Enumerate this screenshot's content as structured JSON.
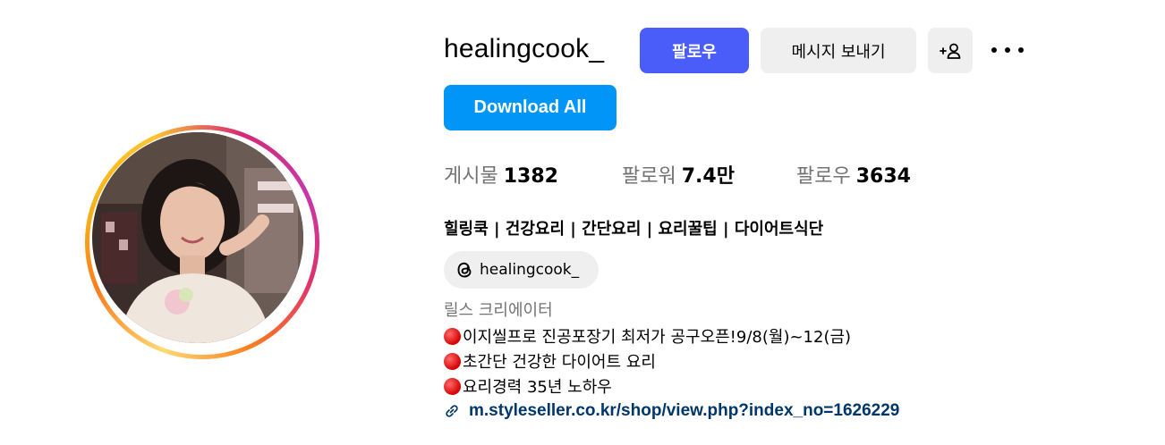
{
  "profile": {
    "username": "healingcook_",
    "follow_button": "팔로우",
    "message_button": "메시지 보내기",
    "download_button": "Download All"
  },
  "stats": [
    {
      "label": "게시물",
      "value": "1382"
    },
    {
      "label": "팔로워",
      "value": "7.4만"
    },
    {
      "label": "팔로우",
      "value": "3634"
    }
  ],
  "bio": {
    "title": "힐링쿡 | 건강요리 | 간단요리 | 요리꿀팁 | 다이어트식단",
    "threads_handle": "healingcook_",
    "category": "릴스 크리에이터",
    "lines": [
      "이지씰프로 진공포장기 최저가 공구오픈!9/8(월)~12(금)",
      "초간단 건강한 다이어트 요리",
      "요리경력 35년 노하우"
    ],
    "link": "m.styleseller.co.kr/shop/view.php?index_no=1626229"
  },
  "icons": {
    "add_user": "add-user-icon",
    "more": "more-options-icon",
    "threads": "threads-icon",
    "link": "link-icon",
    "bullet": "red-circle-emoji"
  },
  "colors": {
    "follow_button": "#4a5df9",
    "download_button": "#0095f6",
    "secondary_button": "#efefef",
    "link_text": "#00376b",
    "muted_text": "#737373"
  }
}
